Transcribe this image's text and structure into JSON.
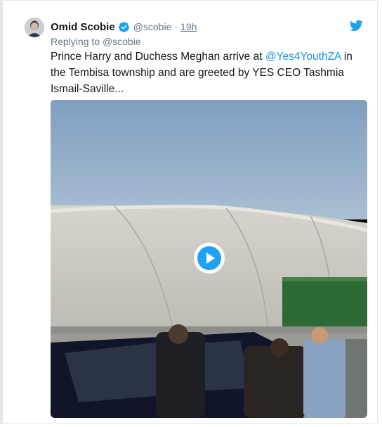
{
  "tweet": {
    "author_name": "Omid Scobie",
    "handle": "@scobie",
    "separator": "·",
    "time": "19h",
    "replying_prefix": "Replying to",
    "replying_handle": "@scobie",
    "text_before": "Prince Harry and Duchess Meghan arrive at ",
    "mention": "@Yes4YouthZA",
    "text_after": " in the Tembisa township and are greeted by YES CEO Tashmia Ismail-Saville..."
  },
  "icons": {
    "verified": "verified-badge-icon",
    "bird": "twitter-bird-icon",
    "play": "play-icon"
  },
  "colors": {
    "accent": "#1da1f2",
    "link": "#1b95e0",
    "muted": "#657786",
    "text": "#14171a"
  }
}
